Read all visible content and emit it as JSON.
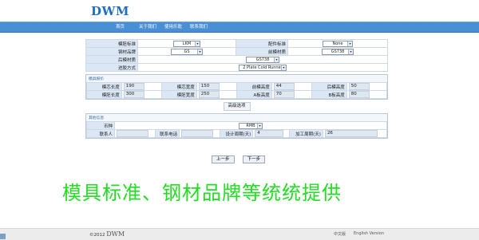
{
  "header": {
    "logo": "DWM"
  },
  "nav": {
    "items": [
      "首页",
      "关于我们",
      "使用乐乾",
      "联系我们"
    ]
  },
  "basic": {
    "mold_standard_label": "模胚标准",
    "mold_standard_value": "LKM",
    "part_standard_label": "配件标准",
    "part_standard_value": "None",
    "steel_brand_label": "钢材品牌",
    "steel_brand_value": "GS",
    "front_mold_label": "前模材质",
    "front_mold_value": "GS738",
    "rear_mold_label": "后模材质",
    "rear_mold_value": "GS738",
    "runner_label": "进胶方式",
    "runner_value": "2 Plate Cold Runner"
  },
  "mold_size": {
    "title": "模具报价",
    "rows": [
      [
        {
          "label": "模芯长度",
          "value": "190"
        },
        {
          "label": "模芯宽度",
          "value": "150"
        },
        {
          "label": "前模高度",
          "value": "44"
        },
        {
          "label": "后模高度",
          "value": "50"
        }
      ],
      [
        {
          "label": "模胚长度",
          "value": "300"
        },
        {
          "label": "模胚宽度",
          "value": "250"
        },
        {
          "label": "A板高度",
          "value": "70"
        },
        {
          "label": "B板高度",
          "value": "80"
        }
      ]
    ]
  },
  "advanced_button": "高级选项",
  "other": {
    "title": "其他信息",
    "currency_label": "币种",
    "currency_value": "RMB",
    "contact_label": "联系人",
    "contact_value": "",
    "phone_label": "联系电话",
    "phone_value": "",
    "design_label": "设计周期(天)",
    "design_value": "4",
    "process_label": "加工周期(天)",
    "process_value": "26"
  },
  "buttons": {
    "prev": "上一步",
    "next": "下一步"
  },
  "banner": "模具标准、钢材品牌等统统提供",
  "footer": {
    "copyright": "©2012",
    "brand": "DWM",
    "lang_cn": "中文版",
    "lang_en": "English Version"
  }
}
